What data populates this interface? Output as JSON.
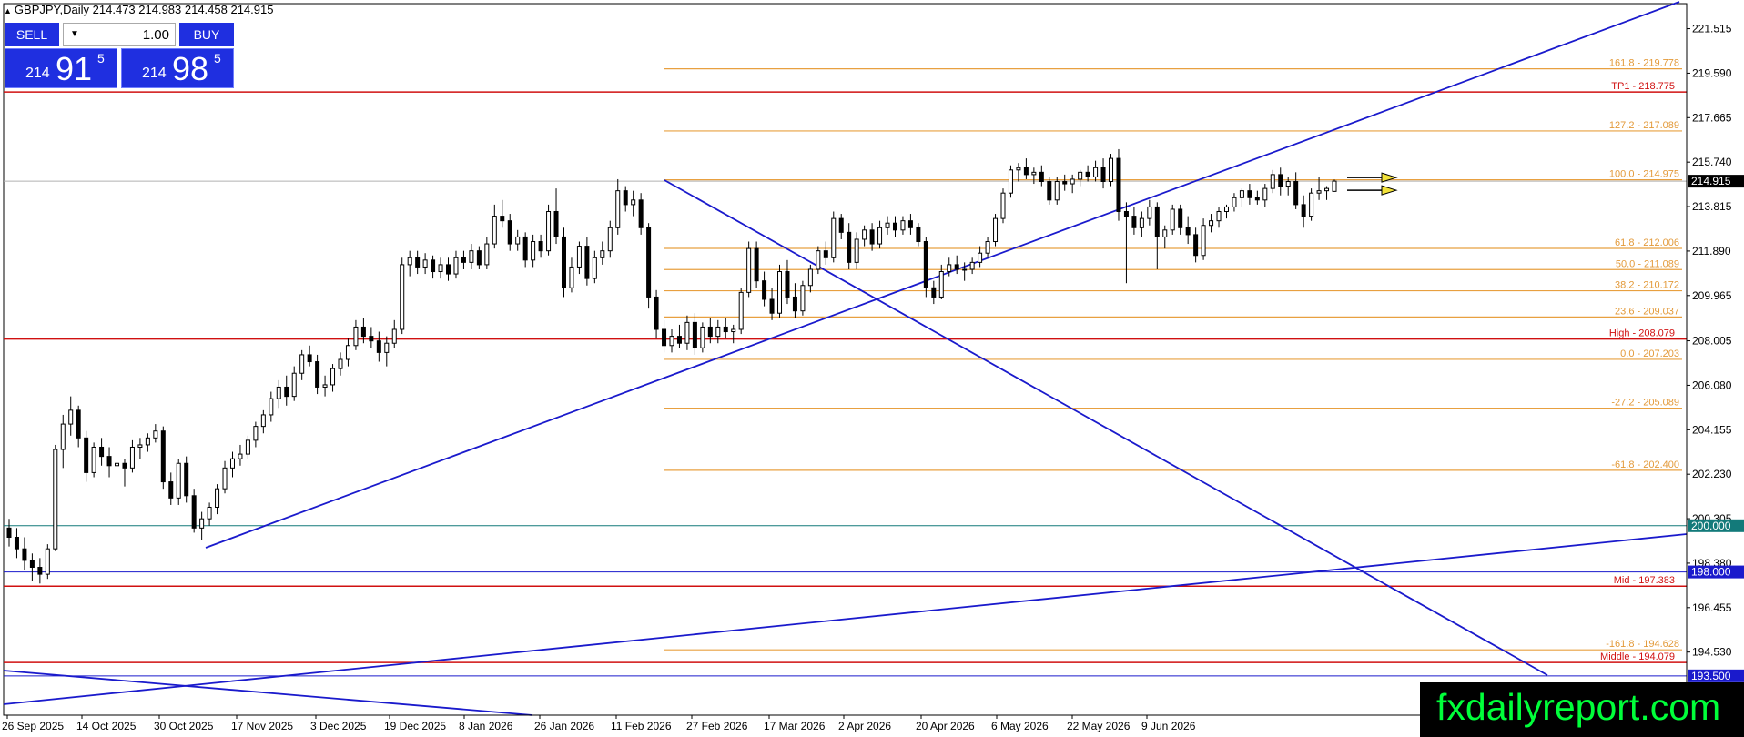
{
  "header": {
    "symbol_line": "GBPJPY,Daily  214.473 214.983 214.458 214.915"
  },
  "trade_panel": {
    "sell_label": "SELL",
    "buy_label": "BUY",
    "lot_value": "1.00",
    "sell_price": {
      "prefix": "214",
      "big": "91",
      "sup": "5"
    },
    "buy_price": {
      "prefix": "214",
      "big": "98",
      "sup": "5"
    }
  },
  "watermark": "fxdailyreport.com",
  "colors": {
    "up_candle": "#ffffff",
    "down_candle": "#000000",
    "trendline": "#1a1acc",
    "fib": "#e8a040",
    "fib_text": "#e39a3a",
    "red_level": "#d01010",
    "teal_level": "#137a7a",
    "blue_level": "#1a1acc"
  },
  "chart_data": {
    "type": "candlestick",
    "symbol": "GBPJPY",
    "timeframe": "Daily",
    "ohlc_last": {
      "open": 214.473,
      "high": 214.983,
      "low": 214.458,
      "close": 214.915
    },
    "ylim": [
      191.8,
      222.6
    ],
    "y_ticks": [
      "221.515",
      "219.590",
      "217.665",
      "215.740",
      "213.815",
      "211.890",
      "209.965",
      "208.005",
      "206.080",
      "204.155",
      "202.230",
      "200.305",
      "198.380",
      "196.455",
      "194.530"
    ],
    "x_tick_labels": [
      "26 Sep 2025",
      "14 Oct 2025",
      "30 Oct 2025",
      "17 Nov 2025",
      "3 Dec 2025",
      "19 Dec 2025",
      "8 Jan 2026",
      "26 Jan 2026",
      "11 Feb 2026",
      "27 Feb 2026",
      "17 Mar 2026",
      "2 Apr 2026",
      "20 Apr 2026",
      "6 May 2026",
      "22 May 2026",
      "9 Jun 2026"
    ],
    "current_price_label": "214.915",
    "levels": [
      {
        "label": "TP1 - 218.775",
        "price": 218.775,
        "kind": "red"
      },
      {
        "label": "High - 208.079",
        "price": 208.079,
        "kind": "red"
      },
      {
        "label": "Mid - 197.383",
        "price": 197.383,
        "kind": "red"
      },
      {
        "label": "Middle - 194.079",
        "price": 194.079,
        "kind": "red"
      },
      {
        "label": "200.000",
        "price": 200.0,
        "kind": "teal"
      },
      {
        "label": "198.000",
        "price": 198.0,
        "kind": "blue"
      },
      {
        "label": "193.500",
        "price": 193.5,
        "kind": "blue"
      }
    ],
    "fibonacci": [
      {
        "label": "161.8 - 219.778",
        "price": 219.778
      },
      {
        "label": "127.2 - 217.089",
        "price": 217.089
      },
      {
        "label": "100.0 - 214.975",
        "price": 214.975
      },
      {
        "label": "61.8 - 212.006",
        "price": 212.006
      },
      {
        "label": "50.0 - 211.089",
        "price": 211.089
      },
      {
        "label": "38.2 - 210.172",
        "price": 210.172
      },
      {
        "label": "23.6 - 209.037",
        "price": 209.037
      },
      {
        "label": "0.0 - 207.203",
        "price": 207.203
      },
      {
        "label": "-27.2 - 205.089",
        "price": 205.089
      },
      {
        "label": "-61.8 - 202.400",
        "price": 202.4
      },
      {
        "label": "-161.8 - 194.628",
        "price": 194.628
      }
    ],
    "candles": [
      [
        199.9,
        200.3,
        199.1,
        199.5
      ],
      [
        199.5,
        199.9,
        198.6,
        199.0
      ],
      [
        199.0,
        199.5,
        198.1,
        198.5
      ],
      [
        198.5,
        198.8,
        197.6,
        198.2
      ],
      [
        198.2,
        198.6,
        197.5,
        197.9
      ],
      [
        197.9,
        199.2,
        197.7,
        199.0
      ],
      [
        199.0,
        203.5,
        198.9,
        203.3
      ],
      [
        203.3,
        204.8,
        202.5,
        204.4
      ],
      [
        204.4,
        205.6,
        203.9,
        205.0
      ],
      [
        205.0,
        205.2,
        203.4,
        203.8
      ],
      [
        203.8,
        204.1,
        201.9,
        202.3
      ],
      [
        202.3,
        203.6,
        202.1,
        203.4
      ],
      [
        203.4,
        203.8,
        202.6,
        203.0
      ],
      [
        203.0,
        203.4,
        202.1,
        202.6
      ],
      [
        202.6,
        203.2,
        202.4,
        202.7
      ],
      [
        202.7,
        202.9,
        201.7,
        202.5
      ],
      [
        202.5,
        203.7,
        202.3,
        203.4
      ],
      [
        203.4,
        203.8,
        202.9,
        203.5
      ],
      [
        203.5,
        204.0,
        203.2,
        203.8
      ],
      [
        203.8,
        204.4,
        203.6,
        204.1
      ],
      [
        204.1,
        204.3,
        201.6,
        201.9
      ],
      [
        201.9,
        202.3,
        200.9,
        201.2
      ],
      [
        201.2,
        202.9,
        200.9,
        202.7
      ],
      [
        202.7,
        203.0,
        201.0,
        201.3
      ],
      [
        201.3,
        201.6,
        199.7,
        199.9
      ],
      [
        199.9,
        200.6,
        199.4,
        200.3
      ],
      [
        200.3,
        201.0,
        200.0,
        200.8
      ],
      [
        200.8,
        201.8,
        200.5,
        201.6
      ],
      [
        201.6,
        202.8,
        201.4,
        202.5
      ],
      [
        202.5,
        203.2,
        202.1,
        202.9
      ],
      [
        202.9,
        203.5,
        202.6,
        203.1
      ],
      [
        203.1,
        203.9,
        202.9,
        203.7
      ],
      [
        203.7,
        204.5,
        203.4,
        204.3
      ],
      [
        204.3,
        205.0,
        204.0,
        204.8
      ],
      [
        204.8,
        205.8,
        204.5,
        205.5
      ],
      [
        205.5,
        206.3,
        205.1,
        206.0
      ],
      [
        206.0,
        206.5,
        205.2,
        205.6
      ],
      [
        205.6,
        206.9,
        205.4,
        206.6
      ],
      [
        206.6,
        207.6,
        206.3,
        207.4
      ],
      [
        207.4,
        207.8,
        206.9,
        207.1
      ],
      [
        207.1,
        207.4,
        205.7,
        206.0
      ],
      [
        206.0,
        206.5,
        205.6,
        206.1
      ],
      [
        206.1,
        207.0,
        205.8,
        206.8
      ],
      [
        206.8,
        207.5,
        206.5,
        207.2
      ],
      [
        207.2,
        208.1,
        206.9,
        207.8
      ],
      [
        207.8,
        208.9,
        207.6,
        208.6
      ],
      [
        208.6,
        209.0,
        207.9,
        208.2
      ],
      [
        208.2,
        208.6,
        207.7,
        208.0
      ],
      [
        208.0,
        208.4,
        207.1,
        207.5
      ],
      [
        207.5,
        208.2,
        206.9,
        207.9
      ],
      [
        207.9,
        208.9,
        207.7,
        208.5
      ],
      [
        208.5,
        211.6,
        208.3,
        211.3
      ],
      [
        211.3,
        211.9,
        210.8,
        211.6
      ],
      [
        211.6,
        211.9,
        210.9,
        211.2
      ],
      [
        211.2,
        211.8,
        210.9,
        211.5
      ],
      [
        211.5,
        211.7,
        210.7,
        211.0
      ],
      [
        211.0,
        211.6,
        210.7,
        211.3
      ],
      [
        211.3,
        211.6,
        210.6,
        210.9
      ],
      [
        210.9,
        211.9,
        210.7,
        211.6
      ],
      [
        211.6,
        211.9,
        211.1,
        211.4
      ],
      [
        211.4,
        212.2,
        211.1,
        211.9
      ],
      [
        211.9,
        212.1,
        211.1,
        211.3
      ],
      [
        211.3,
        212.5,
        211.1,
        212.2
      ],
      [
        212.2,
        213.9,
        212.0,
        213.4
      ],
      [
        213.4,
        214.1,
        212.9,
        213.2
      ],
      [
        213.2,
        213.5,
        211.9,
        212.2
      ],
      [
        212.2,
        212.8,
        211.9,
        212.5
      ],
      [
        212.5,
        212.7,
        211.2,
        211.5
      ],
      [
        211.5,
        212.6,
        211.2,
        212.3
      ],
      [
        212.3,
        212.6,
        211.6,
        211.9
      ],
      [
        211.9,
        213.9,
        211.7,
        213.6
      ],
      [
        213.6,
        214.6,
        212.2,
        212.5
      ],
      [
        212.5,
        212.9,
        209.9,
        210.3
      ],
      [
        210.3,
        211.6,
        210.1,
        211.2
      ],
      [
        211.2,
        212.3,
        210.9,
        212.1
      ],
      [
        212.1,
        212.5,
        210.4,
        210.7
      ],
      [
        210.7,
        211.9,
        210.5,
        211.6
      ],
      [
        211.6,
        212.3,
        211.3,
        211.9
      ],
      [
        211.9,
        213.2,
        211.6,
        212.9
      ],
      [
        212.9,
        215.0,
        212.6,
        214.5
      ],
      [
        214.5,
        214.7,
        213.6,
        213.9
      ],
      [
        213.9,
        214.5,
        213.4,
        214.1
      ],
      [
        214.1,
        214.4,
        212.6,
        212.9
      ],
      [
        212.9,
        213.1,
        209.4,
        209.9
      ],
      [
        209.9,
        210.2,
        208.1,
        208.5
      ],
      [
        208.5,
        208.9,
        207.5,
        207.8
      ],
      [
        207.8,
        208.5,
        207.5,
        208.2
      ],
      [
        208.2,
        208.7,
        207.7,
        207.9
      ],
      [
        207.9,
        209.1,
        207.6,
        208.8
      ],
      [
        208.8,
        209.2,
        207.4,
        207.7
      ],
      [
        207.7,
        208.8,
        207.5,
        208.6
      ],
      [
        208.6,
        209.0,
        207.9,
        208.2
      ],
      [
        208.2,
        208.9,
        207.9,
        208.6
      ],
      [
        208.6,
        209.0,
        208.1,
        208.4
      ],
      [
        208.4,
        208.7,
        207.9,
        208.5
      ],
      [
        208.5,
        210.3,
        208.3,
        210.1
      ],
      [
        210.1,
        212.3,
        209.9,
        212.0
      ],
      [
        212.0,
        212.3,
        210.3,
        210.6
      ],
      [
        210.6,
        211.0,
        209.5,
        209.8
      ],
      [
        209.8,
        210.3,
        208.9,
        209.2
      ],
      [
        209.2,
        211.3,
        209.0,
        211.0
      ],
      [
        211.0,
        211.5,
        209.6,
        209.9
      ],
      [
        209.9,
        210.5,
        209.0,
        209.3
      ],
      [
        209.3,
        210.6,
        209.1,
        210.4
      ],
      [
        210.4,
        211.3,
        210.1,
        211.1
      ],
      [
        211.1,
        212.1,
        210.9,
        211.9
      ],
      [
        211.9,
        212.3,
        211.3,
        211.6
      ],
      [
        211.6,
        213.6,
        211.4,
        213.3
      ],
      [
        213.3,
        213.5,
        212.4,
        212.7
      ],
      [
        212.7,
        213.1,
        211.1,
        211.4
      ],
      [
        211.4,
        212.7,
        211.1,
        212.4
      ],
      [
        212.4,
        213.0,
        212.1,
        212.8
      ],
      [
        212.8,
        213.1,
        211.9,
        212.2
      ],
      [
        212.2,
        213.2,
        212.0,
        212.9
      ],
      [
        212.9,
        213.4,
        212.6,
        213.1
      ],
      [
        213.1,
        213.4,
        212.5,
        212.8
      ],
      [
        212.8,
        213.4,
        212.6,
        213.2
      ],
      [
        213.2,
        213.5,
        212.6,
        212.9
      ],
      [
        212.9,
        213.1,
        212.1,
        212.3
      ],
      [
        212.3,
        212.5,
        209.9,
        210.3
      ],
      [
        210.3,
        210.6,
        209.6,
        209.9
      ],
      [
        209.9,
        211.3,
        209.8,
        211.0
      ],
      [
        211.0,
        211.6,
        210.8,
        211.3
      ],
      [
        211.3,
        211.7,
        210.9,
        211.1
      ],
      [
        211.1,
        211.4,
        210.6,
        211.1
      ],
      [
        211.1,
        211.6,
        210.9,
        211.4
      ],
      [
        211.4,
        212.1,
        211.2,
        211.8
      ],
      [
        211.8,
        212.5,
        211.6,
        212.3
      ],
      [
        212.3,
        213.5,
        212.1,
        213.3
      ],
      [
        213.3,
        214.6,
        213.1,
        214.4
      ],
      [
        214.4,
        215.6,
        214.2,
        215.4
      ],
      [
        215.4,
        215.7,
        214.9,
        215.5
      ],
      [
        215.5,
        215.9,
        215.0,
        215.2
      ],
      [
        215.2,
        215.5,
        214.8,
        215.3
      ],
      [
        215.3,
        215.6,
        214.7,
        214.9
      ],
      [
        214.9,
        215.1,
        213.9,
        214.1
      ],
      [
        214.1,
        215.1,
        213.9,
        214.9
      ],
      [
        214.9,
        215.2,
        214.5,
        214.8
      ],
      [
        214.8,
        215.2,
        214.4,
        215.0
      ],
      [
        215.0,
        215.4,
        214.7,
        215.3
      ],
      [
        215.3,
        215.6,
        214.9,
        215.1
      ],
      [
        215.1,
        215.8,
        214.9,
        215.5
      ],
      [
        215.5,
        215.9,
        214.6,
        214.9
      ],
      [
        214.9,
        216.1,
        214.7,
        215.9
      ],
      [
        215.9,
        216.3,
        213.2,
        213.6
      ],
      [
        213.6,
        214.0,
        210.5,
        213.4
      ],
      [
        213.4,
        213.8,
        212.6,
        212.9
      ],
      [
        212.9,
        213.6,
        212.5,
        213.3
      ],
      [
        213.3,
        214.1,
        213.0,
        213.8
      ],
      [
        213.8,
        214.0,
        211.1,
        212.5
      ],
      [
        212.5,
        213.0,
        212.0,
        212.8
      ],
      [
        212.8,
        213.9,
        212.6,
        213.7
      ],
      [
        213.7,
        213.9,
        212.6,
        212.9
      ],
      [
        212.9,
        213.4,
        212.2,
        212.6
      ],
      [
        212.6,
        212.9,
        211.4,
        211.7
      ],
      [
        211.7,
        213.3,
        211.5,
        213.0
      ],
      [
        213.0,
        213.5,
        212.7,
        213.2
      ],
      [
        213.2,
        213.8,
        212.9,
        213.6
      ],
      [
        213.6,
        213.9,
        213.3,
        213.8
      ],
      [
        213.8,
        214.4,
        213.6,
        214.2
      ],
      [
        214.2,
        214.6,
        213.8,
        214.5
      ],
      [
        214.5,
        214.8,
        213.9,
        214.2
      ],
      [
        214.2,
        214.5,
        213.9,
        214.1
      ],
      [
        214.1,
        214.8,
        213.8,
        214.6
      ],
      [
        214.6,
        215.4,
        214.4,
        215.2
      ],
      [
        215.2,
        215.5,
        214.3,
        214.7
      ],
      [
        214.7,
        215.1,
        214.3,
        214.9
      ],
      [
        214.9,
        215.3,
        213.7,
        213.9
      ],
      [
        213.9,
        214.3,
        212.9,
        213.4
      ],
      [
        213.4,
        214.6,
        213.2,
        214.4
      ],
      [
        214.4,
        215.1,
        214.1,
        214.5
      ],
      [
        214.5,
        214.7,
        214.1,
        214.6
      ],
      [
        214.473,
        214.983,
        214.458,
        214.915
      ]
    ]
  }
}
